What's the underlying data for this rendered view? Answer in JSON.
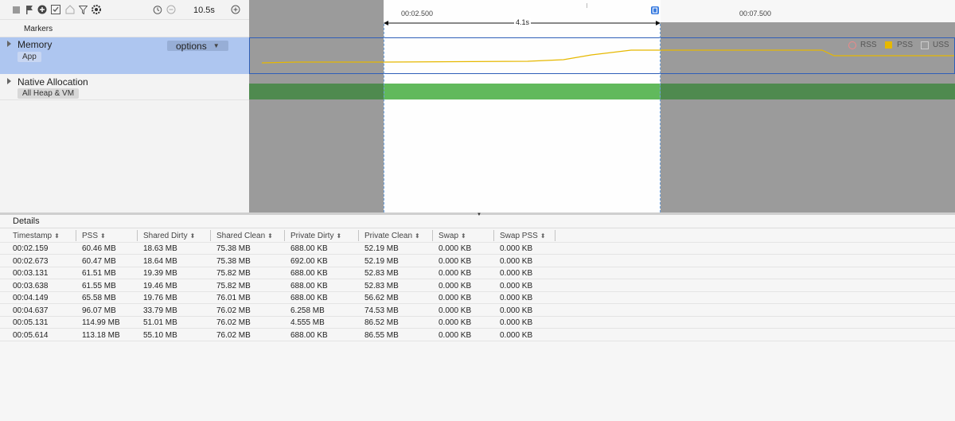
{
  "toolbar": {
    "icons": [
      "stop-icon",
      "flag-icon",
      "record-icon",
      "capture-icon",
      "home-icon",
      "filter-icon",
      "settings-icon"
    ],
    "duration": "10.5s"
  },
  "left": {
    "markers": "Markers",
    "memory": {
      "title": "Memory",
      "tag": "App",
      "options": "options"
    },
    "native": {
      "title": "Native Allocation",
      "tag": "All Heap & VM"
    }
  },
  "ruler": {
    "t1": "00:02.500",
    "t2": "00:07.500",
    "selection": "4.1s"
  },
  "legend": {
    "rss": "RSS",
    "pss": "PSS",
    "uss": "USS",
    "pss_color": "#e6b800"
  },
  "details": {
    "title": "Details",
    "columns": [
      "Timestamp",
      "PSS",
      "Shared Dirty",
      "Shared Clean",
      "Private Dirty",
      "Private Clean",
      "Swap",
      "Swap PSS"
    ],
    "rows": [
      [
        "00:02.159",
        "60.46 MB",
        "18.63 MB",
        "75.38 MB",
        "688.00 KB",
        "52.19 MB",
        "0.000 KB",
        "0.000 KB"
      ],
      [
        "00:02.673",
        "60.47 MB",
        "18.64 MB",
        "75.38 MB",
        "692.00 KB",
        "52.19 MB",
        "0.000 KB",
        "0.000 KB"
      ],
      [
        "00:03.131",
        "61.51 MB",
        "19.39 MB",
        "75.82 MB",
        "688.00 KB",
        "52.83 MB",
        "0.000 KB",
        "0.000 KB"
      ],
      [
        "00:03.638",
        "61.55 MB",
        "19.46 MB",
        "75.82 MB",
        "688.00 KB",
        "52.83 MB",
        "0.000 KB",
        "0.000 KB"
      ],
      [
        "00:04.149",
        "65.58 MB",
        "19.76 MB",
        "76.01 MB",
        "688.00 KB",
        "56.62 MB",
        "0.000 KB",
        "0.000 KB"
      ],
      [
        "00:04.637",
        "96.07 MB",
        "33.79 MB",
        "76.02 MB",
        "6.258 MB",
        "74.53 MB",
        "0.000 KB",
        "0.000 KB"
      ],
      [
        "00:05.131",
        "114.99 MB",
        "51.01 MB",
        "76.02 MB",
        "4.555 MB",
        "86.52 MB",
        "0.000 KB",
        "0.000 KB"
      ],
      [
        "00:05.614",
        "113.18 MB",
        "55.10 MB",
        "76.02 MB",
        "688.00 KB",
        "86.55 MB",
        "0.000 KB",
        "0.000 KB"
      ]
    ]
  }
}
